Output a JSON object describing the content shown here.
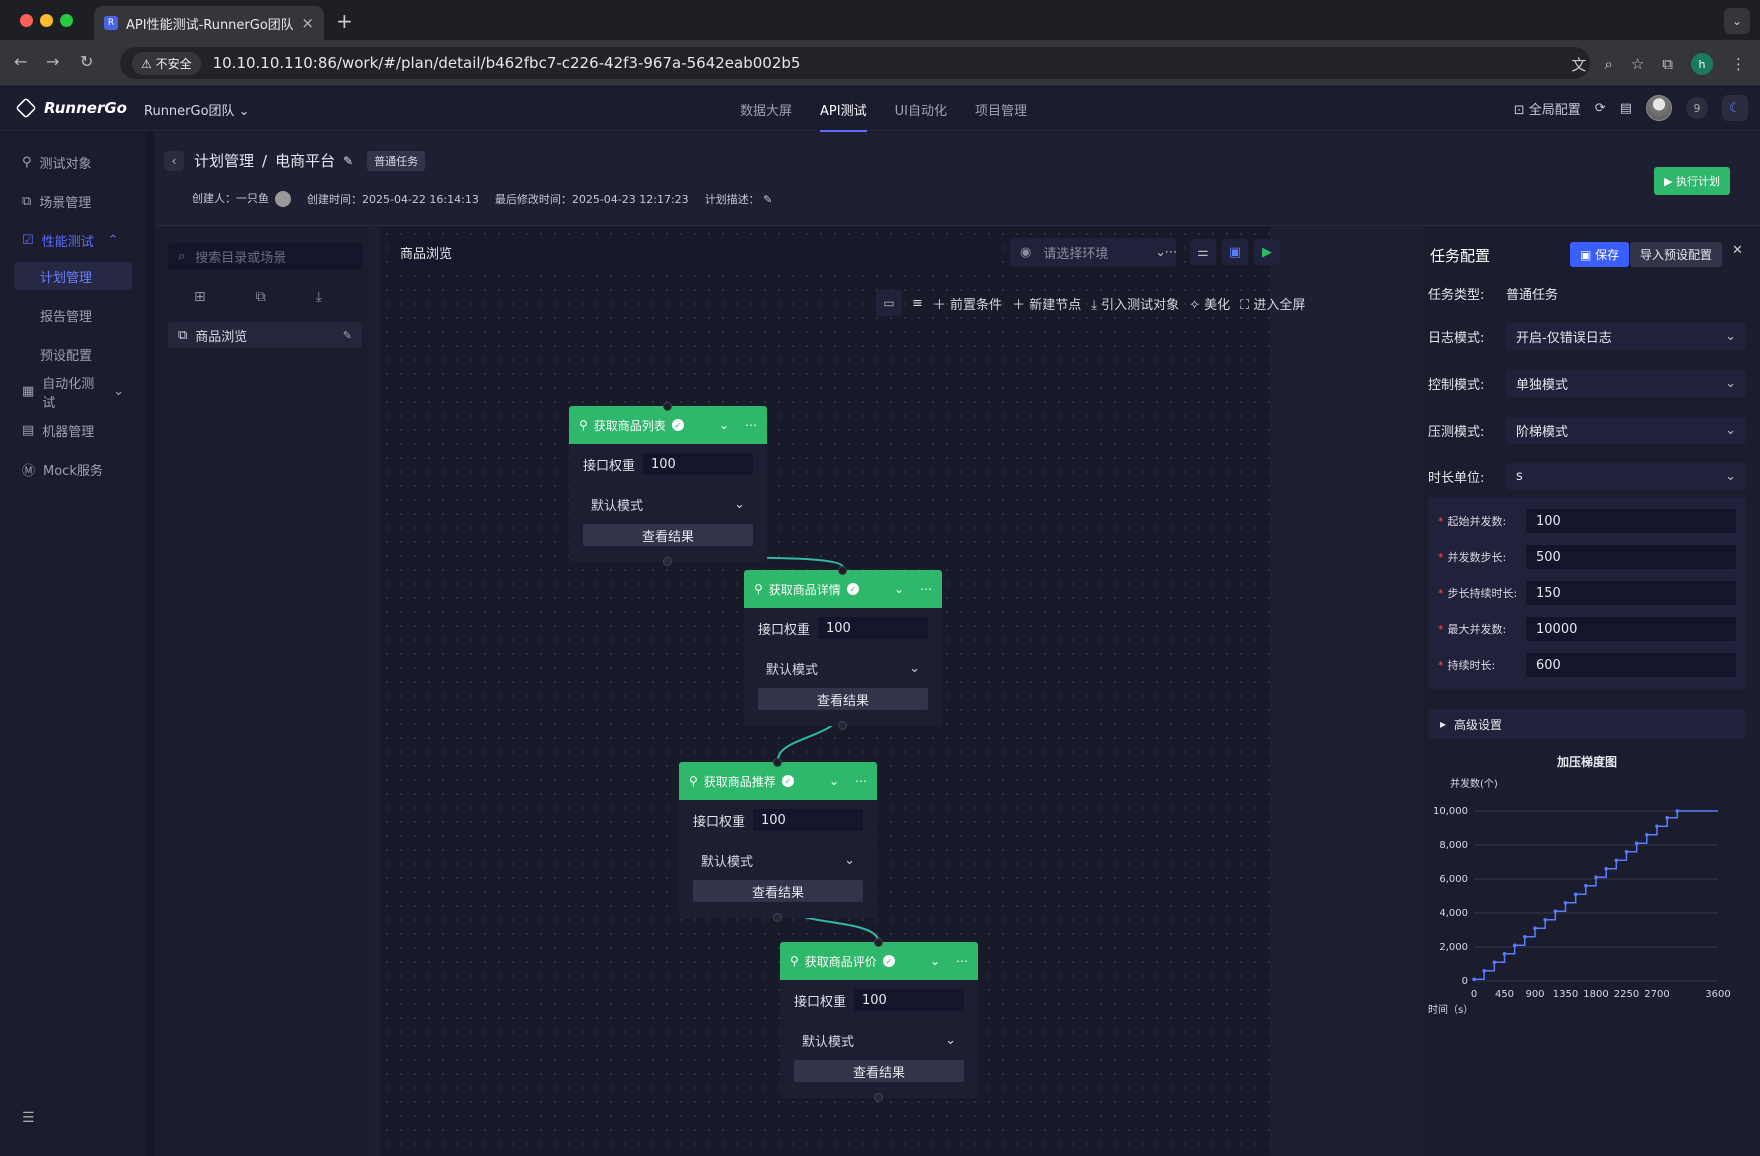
{
  "browser": {
    "tab_title": "API性能测试-RunnerGo团队",
    "insecure_label": "不安全",
    "url": "10.10.10.110:86/work/#/plan/detail/b462fbc7-c226-42f3-967a-5642eab002b5",
    "profile_initial": "h"
  },
  "app": {
    "brand": "RunnerGo",
    "team": "RunnerGo团队",
    "nav": [
      "数据大屏",
      "API测试",
      "UI自动化",
      "项目管理"
    ],
    "active_nav": "API测试",
    "global_config": "全局配置",
    "member_count": "9"
  },
  "sidebar": {
    "items": [
      {
        "label": "测试对象"
      },
      {
        "label": "场景管理"
      },
      {
        "label": "性能测试"
      },
      {
        "label": "计划管理"
      },
      {
        "label": "报告管理"
      },
      {
        "label": "预设配置"
      },
      {
        "label": "自动化测试"
      },
      {
        "label": "机器管理"
      },
      {
        "label": "Mock服务"
      }
    ]
  },
  "header": {
    "crumb_root": "计划管理",
    "crumb_sep": "/",
    "crumb_current": "电商平台",
    "task_tag": "普通任务",
    "creator_label": "创建人：",
    "creator": "一只鱼",
    "created_label": "创建时间：",
    "created": "2025-04-22 16:14:13",
    "modified_label": "最后修改时间：",
    "modified": "2025-04-23 12:17:23",
    "desc_label": "计划描述：",
    "run_button": "执行计划"
  },
  "tree": {
    "search_placeholder": "搜索目录或场景",
    "item": "商品浏览"
  },
  "canvas": {
    "scene_name": "商品浏览",
    "env_placeholder": "请选择环境",
    "tools": [
      "前置条件",
      "新建节点",
      "引入测试对象",
      "美化",
      "进入全屏"
    ],
    "node_labels": {
      "weight": "接口权重",
      "mode": "默认模式",
      "result": "查看结果"
    },
    "nodes": [
      {
        "title": "获取商品列表",
        "weight": "100"
      },
      {
        "title": "获取商品详情",
        "weight": "100"
      },
      {
        "title": "获取商品推荐",
        "weight": "100"
      },
      {
        "title": "获取商品评价",
        "weight": "100"
      }
    ]
  },
  "config": {
    "title": "任务配置",
    "save": "保存",
    "import": "导入预设配置",
    "task_type_label": "任务类型:",
    "task_type": "普通任务",
    "log_label": "日志模式:",
    "log": "开启-仅错误日志",
    "control_label": "控制模式:",
    "control": "单独模式",
    "pressure_label": "压测模式:",
    "pressure": "阶梯模式",
    "unit_label": "时长单位:",
    "unit": "s",
    "stage": [
      {
        "label": "起始并发数:",
        "value": "100"
      },
      {
        "label": "并发数步长:",
        "value": "500"
      },
      {
        "label": "步长持续时长:",
        "value": "150"
      },
      {
        "label": "最大并发数:",
        "value": "10000"
      },
      {
        "label": "持续时长:",
        "value": "600"
      }
    ],
    "advanced": "高级设置"
  },
  "chart_data": {
    "type": "line",
    "title": "加压梯度图",
    "ylabel": "并发数(个)",
    "xlabel": "时间（s）",
    "xlim": [
      0,
      3600
    ],
    "ylim": [
      0,
      10000
    ],
    "xticks": [
      0,
      450,
      900,
      1350,
      1800,
      2250,
      2700,
      3600
    ],
    "yticks": [
      "0",
      "2,000",
      "4,000",
      "6,000",
      "8,000",
      "10,000"
    ],
    "step_series": {
      "start": 100,
      "step": 500,
      "step_duration": 150,
      "max": 10000,
      "hold": 600
    },
    "color": "#5b7cff"
  }
}
